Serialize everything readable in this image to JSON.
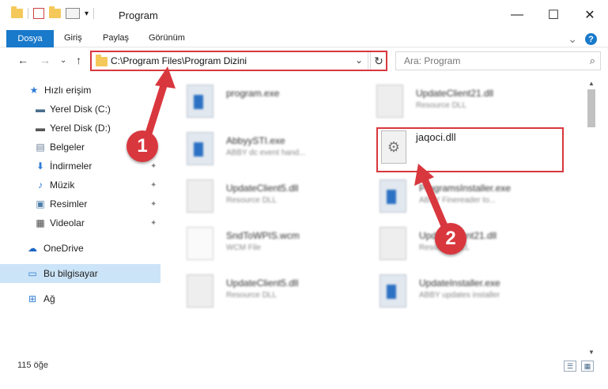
{
  "window": {
    "title": "Program",
    "minimize_glyph": "—",
    "maximize_glyph": "☐",
    "close_glyph": "✕"
  },
  "ribbon": {
    "tabs": [
      "Dosya",
      "Giriş",
      "Paylaş",
      "Görünüm"
    ],
    "expand_glyph": "⌄",
    "help_glyph": "?"
  },
  "nav": {
    "back_glyph": "←",
    "forward_glyph": "→",
    "recent_glyph": "⌄",
    "up_glyph": "↑",
    "address": "C:\\Program Files\\Program Dizini",
    "address_dropdown_glyph": "⌄",
    "refresh_glyph": "↻",
    "search_placeholder": "Ara: Program",
    "search_glyph": "⌕"
  },
  "sidebar": {
    "items": [
      {
        "label": "Hızlı erişim",
        "icon": "star-icon",
        "glyph": "★",
        "color": "#2e7bd6",
        "pinned": false,
        "selected": false
      },
      {
        "label": "Yerel Disk (C:)",
        "icon": "drive-icon",
        "glyph": "▬",
        "color": "#4a6d8c",
        "pinned": false,
        "selected": false
      },
      {
        "label": "Yerel Disk (D:)",
        "icon": "drive-icon",
        "glyph": "▬",
        "color": "#555555",
        "pinned": false,
        "selected": false
      },
      {
        "label": "Belgeler",
        "icon": "documents-icon",
        "glyph": "▤",
        "color": "#6a7f96",
        "pinned": true,
        "selected": false
      },
      {
        "label": "İndirmeler",
        "icon": "downloads-icon",
        "glyph": "⬇",
        "color": "#2e7bd6",
        "pinned": true,
        "selected": false
      },
      {
        "label": "Müzik",
        "icon": "music-icon",
        "glyph": "♪",
        "color": "#2e7bd6",
        "pinned": true,
        "selected": false
      },
      {
        "label": "Resimler",
        "icon": "pictures-icon",
        "glyph": "▣",
        "color": "#4f7fa8",
        "pinned": true,
        "selected": false
      },
      {
        "label": "Videolar",
        "icon": "videos-icon",
        "glyph": "▦",
        "color": "#444444",
        "pinned": true,
        "selected": false
      },
      {
        "label": "OneDrive",
        "icon": "onedrive-icon",
        "glyph": "☁",
        "color": "#1a66c2",
        "pinned": false,
        "selected": false
      },
      {
        "label": "Bu bilgisayar",
        "icon": "this-pc-icon",
        "glyph": "▭",
        "color": "#2e7bd6",
        "pinned": false,
        "selected": true
      },
      {
        "label": "Ağ",
        "icon": "network-icon",
        "glyph": "⊞",
        "color": "#2e7bd6",
        "pinned": false,
        "selected": false
      }
    ],
    "pin_glyph": "📌"
  },
  "files": [
    {
      "name": "program.exe",
      "desc": "",
      "kind": "exe"
    },
    {
      "name": "UpdateClient21.dll",
      "desc": "Resource DLL",
      "kind": "dll"
    },
    {
      "name": "AbbyySTI.exe",
      "desc": "ABBY dc event hand...",
      "kind": "exe"
    },
    {
      "name": "jaqoci.dll",
      "desc": "",
      "kind": "dll-highlight"
    },
    {
      "name": "UpdateClient5.dll",
      "desc": "Resource DLL",
      "kind": "dll"
    },
    {
      "name": "ProgramsInstaller.exe",
      "desc": "ABBY Finereader to...",
      "kind": "exe"
    },
    {
      "name": "SndToWPIS.wcm",
      "desc": "WCM File",
      "kind": "doc"
    },
    {
      "name": "UpdateClient21.dll",
      "desc": "Resource DLL",
      "kind": "dll"
    },
    {
      "name": "UpdateClient5.dll",
      "desc": "Resource DLL",
      "kind": "dll"
    },
    {
      "name": "UpdateInstaller.exe",
      "desc": "ABBY updates installer",
      "kind": "exe"
    }
  ],
  "highlight_file_glyph": "⚙",
  "scrollbar": {
    "up_glyph": "▲",
    "down_glyph": "▼"
  },
  "status": {
    "item_count": "115 öğe",
    "details_view_glyph": "☰",
    "icons_view_glyph": "▦"
  },
  "annotations": {
    "step1": "1",
    "step2": "2",
    "accent_color": "#d9373e"
  }
}
